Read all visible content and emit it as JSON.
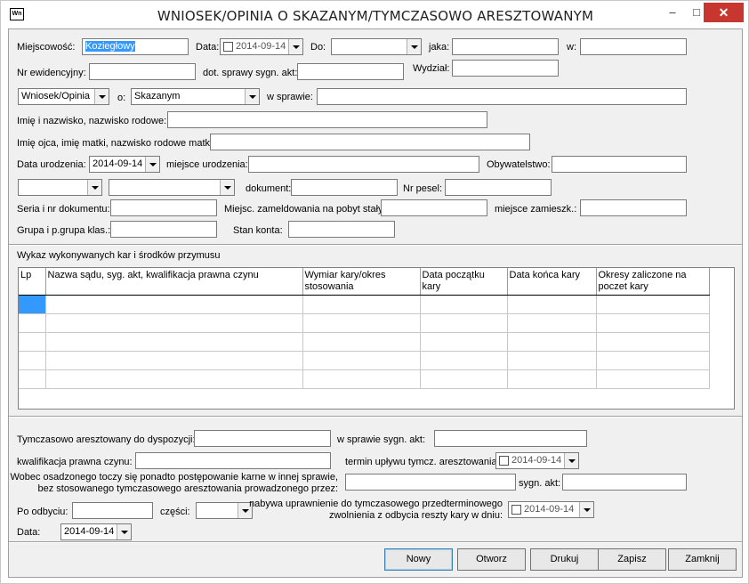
{
  "window": {
    "title": "WNIOSEK/OPINIA O SKAZANYM/TYMCZASOWO ARESZTOWANYM",
    "icon_text": "Wn",
    "minimize": "–",
    "maximize": "□",
    "close": "✕"
  },
  "row1": {
    "miejscowosc_label": "Miejscowość:",
    "miejscowosc_value": "Koziegłowy",
    "data_label": "Data:",
    "data_value": "2014-09-14",
    "do_label": "Do:",
    "do_value": "",
    "jaka_label": "jaka:",
    "jaka_value": "",
    "w_label": "w:",
    "w_value": ""
  },
  "row2": {
    "nr_label": "Nr ewidencyjny:",
    "nr_value": "",
    "dot_label": "dot. sprawy sygn. akt:",
    "dot_value": "",
    "wydzial_label": "Wydział:",
    "wydzial_value": ""
  },
  "row3": {
    "typ_value": "Wniosek/Opinia",
    "o_label": "o:",
    "o_value": "Skazanym",
    "w_sprawie_label": "w sprawie:",
    "w_sprawie_value": ""
  },
  "row4": {
    "label": "Imię i nazwisko, nazwisko rodowe:",
    "value": ""
  },
  "row5": {
    "label": "Imię ojca, imię matki, nazwisko rodowe matki:",
    "value": ""
  },
  "row6": {
    "data_ur_label": "Data urodzenia:",
    "data_ur_value": "2014-09-14",
    "miejsce_label": "miejsce urodzenia:",
    "miejsce_value": "",
    "obyw_label": "Obywatelstwo:",
    "obyw_value": ""
  },
  "row7": {
    "combo1_value": "",
    "combo2_value": "",
    "dokument_label": "dokument:",
    "dokument_value": "",
    "pesel_label": "Nr pesel:",
    "pesel_value": ""
  },
  "row8": {
    "seria_label": "Seria i nr dokumentu:",
    "seria_value": "",
    "zamel_label": "Miejsc. zameldowania na pobyt stały:",
    "zamel_value": "",
    "zamiesz_label": "miejsce zamieszk.:",
    "zamiesz_value": ""
  },
  "row9": {
    "grupa_label": "Grupa i p.grupa klas.:",
    "grupa_value": "",
    "stan_label": "Stan konta:",
    "stan_value": ""
  },
  "grid": {
    "caption": "Wykaz wykonywanych kar i środków przymusu",
    "columns": [
      "Lp",
      "Nazwa sądu, syg. akt, kwalifikacja prawna czynu",
      "Wymiar kary/okres stosowania",
      "Data początku kary",
      "Data końca kary",
      "Okresy zaliczone na poczet kary"
    ],
    "row_count": 5
  },
  "lower": {
    "tymcz_label": "Tymczasowo aresztowany do dyspozycji:",
    "tymcz_value": "",
    "w_sprawie_sygn_label": "w sprawie sygn. akt:",
    "w_sprawie_sygn_value": "",
    "kwal_label": "kwalifikacja prawna czynu:",
    "kwal_value": "",
    "termin_label": "termin upływu tymcz. aresztowania:",
    "termin_value": "2014-09-14",
    "wobec_label_1": "Wobec osadzonego toczy się ponadto postępowanie karne w innej sprawie,",
    "wobec_label_2": "bez stosowanego tymczasowego aresztowania prowadzonego przez:",
    "wobec_value": "",
    "sygn_label": "sygn. akt:",
    "sygn_value": "",
    "po_label": "Po odbyciu:",
    "po_value": "",
    "czesci_label": "części:",
    "czesci_value": "",
    "nabywa_label_1": "nabywa uprawnienie do tymczasowego przedterminowego",
    "nabywa_label_2": "zwolnienia z odbycia reszty kary w dniu:",
    "nabywa_value": "2014-09-14",
    "data_label": "Data:",
    "data_value": "2014-09-14"
  },
  "buttons": {
    "nowy": "Nowy",
    "otworz": "Otworz",
    "drukuj": "Drukuj",
    "zapisz": "Zapisz",
    "zamknij": "Zamknij"
  }
}
